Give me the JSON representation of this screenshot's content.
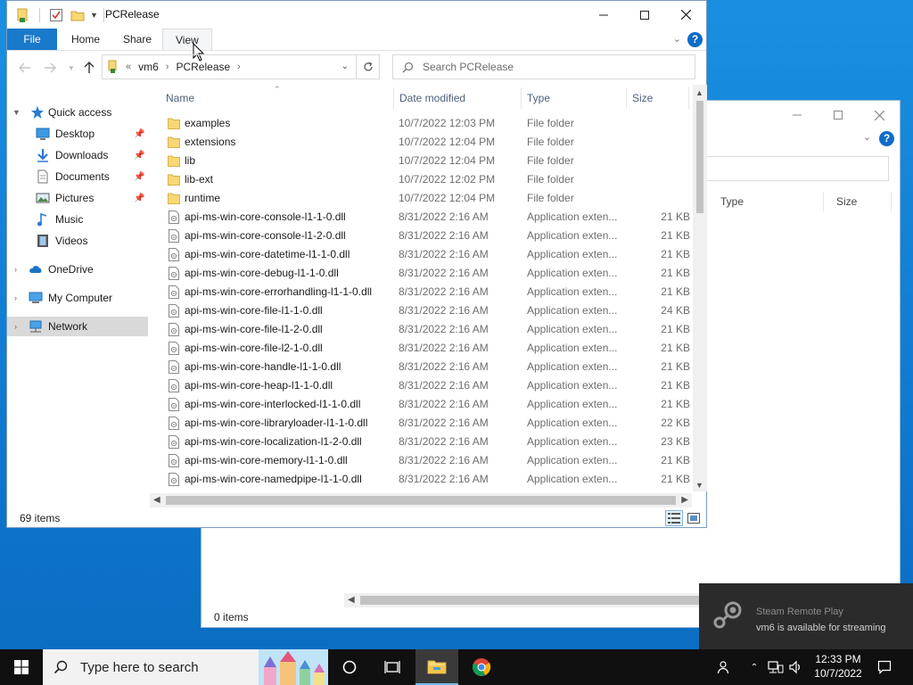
{
  "window": {
    "title": "PCRelease",
    "ribbon_tabs": [
      "File",
      "Home",
      "Share",
      "View"
    ],
    "address": {
      "crumb1": "vm6",
      "crumb2": "PCRelease",
      "overflow": "«"
    },
    "search_placeholder": "Search PCRelease",
    "columns": {
      "name": "Name",
      "date": "Date modified",
      "type": "Type",
      "size": "Size"
    },
    "status": "69 items"
  },
  "nav": {
    "items": [
      {
        "label": "Quick access",
        "icon": "star-icon"
      },
      {
        "label": "Desktop",
        "icon": "desktop-icon",
        "pinned": true
      },
      {
        "label": "Downloads",
        "icon": "download-icon",
        "pinned": true
      },
      {
        "label": "Documents",
        "icon": "documents-icon",
        "pinned": true
      },
      {
        "label": "Pictures",
        "icon": "pictures-icon",
        "pinned": true
      },
      {
        "label": "Music",
        "icon": "music-icon"
      },
      {
        "label": "Videos",
        "icon": "videos-icon"
      },
      {
        "label": "OneDrive",
        "icon": "cloud-icon"
      },
      {
        "label": "My Computer",
        "icon": "computer-icon"
      },
      {
        "label": "Network",
        "icon": "network-icon",
        "selected": true
      }
    ]
  },
  "files": [
    {
      "name": "examples",
      "date": "10/7/2022 12:03 PM",
      "type": "File folder",
      "size": "",
      "kind": "folder"
    },
    {
      "name": "extensions",
      "date": "10/7/2022 12:04 PM",
      "type": "File folder",
      "size": "",
      "kind": "folder"
    },
    {
      "name": "lib",
      "date": "10/7/2022 12:04 PM",
      "type": "File folder",
      "size": "",
      "kind": "folder"
    },
    {
      "name": "lib-ext",
      "date": "10/7/2022 12:02 PM",
      "type": "File folder",
      "size": "",
      "kind": "folder"
    },
    {
      "name": "runtime",
      "date": "10/7/2022 12:04 PM",
      "type": "File folder",
      "size": "",
      "kind": "folder"
    },
    {
      "name": "api-ms-win-core-console-l1-1-0.dll",
      "date": "8/31/2022 2:16 AM",
      "type": "Application exten...",
      "size": "21 KB",
      "kind": "dll"
    },
    {
      "name": "api-ms-win-core-console-l1-2-0.dll",
      "date": "8/31/2022 2:16 AM",
      "type": "Application exten...",
      "size": "21 KB",
      "kind": "dll"
    },
    {
      "name": "api-ms-win-core-datetime-l1-1-0.dll",
      "date": "8/31/2022 2:16 AM",
      "type": "Application exten...",
      "size": "21 KB",
      "kind": "dll"
    },
    {
      "name": "api-ms-win-core-debug-l1-1-0.dll",
      "date": "8/31/2022 2:16 AM",
      "type": "Application exten...",
      "size": "21 KB",
      "kind": "dll"
    },
    {
      "name": "api-ms-win-core-errorhandling-l1-1-0.dll",
      "date": "8/31/2022 2:16 AM",
      "type": "Application exten...",
      "size": "21 KB",
      "kind": "dll"
    },
    {
      "name": "api-ms-win-core-file-l1-1-0.dll",
      "date": "8/31/2022 2:16 AM",
      "type": "Application exten...",
      "size": "24 KB",
      "kind": "dll"
    },
    {
      "name": "api-ms-win-core-file-l1-2-0.dll",
      "date": "8/31/2022 2:16 AM",
      "type": "Application exten...",
      "size": "21 KB",
      "kind": "dll"
    },
    {
      "name": "api-ms-win-core-file-l2-1-0.dll",
      "date": "8/31/2022 2:16 AM",
      "type": "Application exten...",
      "size": "21 KB",
      "kind": "dll"
    },
    {
      "name": "api-ms-win-core-handle-l1-1-0.dll",
      "date": "8/31/2022 2:16 AM",
      "type": "Application exten...",
      "size": "21 KB",
      "kind": "dll"
    },
    {
      "name": "api-ms-win-core-heap-l1-1-0.dll",
      "date": "8/31/2022 2:16 AM",
      "type": "Application exten...",
      "size": "21 KB",
      "kind": "dll"
    },
    {
      "name": "api-ms-win-core-interlocked-l1-1-0.dll",
      "date": "8/31/2022 2:16 AM",
      "type": "Application exten...",
      "size": "21 KB",
      "kind": "dll"
    },
    {
      "name": "api-ms-win-core-libraryloader-l1-1-0.dll",
      "date": "8/31/2022 2:16 AM",
      "type": "Application exten...",
      "size": "22 KB",
      "kind": "dll"
    },
    {
      "name": "api-ms-win-core-localization-l1-2-0.dll",
      "date": "8/31/2022 2:16 AM",
      "type": "Application exten...",
      "size": "23 KB",
      "kind": "dll"
    },
    {
      "name": "api-ms-win-core-memory-l1-1-0.dll",
      "date": "8/31/2022 2:16 AM",
      "type": "Application exten...",
      "size": "21 KB",
      "kind": "dll"
    },
    {
      "name": "api-ms-win-core-namedpipe-l1-1-0.dll",
      "date": "8/31/2022 2:16 AM",
      "type": "Application exten...",
      "size": "21 KB",
      "kind": "dll"
    }
  ],
  "bg_window": {
    "columns": {
      "type": "Type",
      "size": "Size"
    },
    "status": "0 items"
  },
  "toast": {
    "title": "Steam Remote Play",
    "message": "vm6 is available for streaming"
  },
  "taskbar": {
    "search_placeholder": "Type here to search",
    "time": "12:33 PM",
    "date": "10/7/2022"
  },
  "colors": {
    "accent": "#1979ca",
    "selection": "#d9d9d9",
    "folder": "#f8d775",
    "taskbar": "#101010"
  }
}
